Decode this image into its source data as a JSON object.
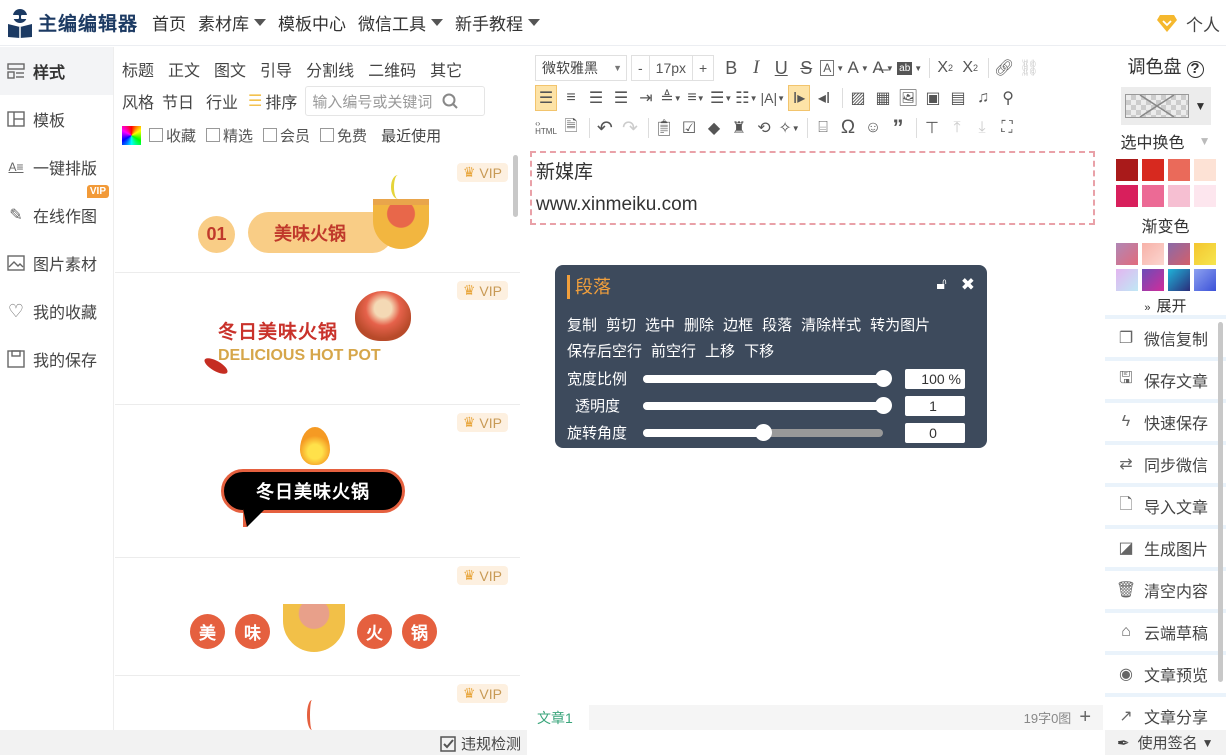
{
  "app": {
    "title": "主编编辑器"
  },
  "nav": [
    {
      "label": "首页",
      "dropdown": false
    },
    {
      "label": "素材库",
      "dropdown": true
    },
    {
      "label": "模板中心",
      "dropdown": false
    },
    {
      "label": "微信工具",
      "dropdown": true
    },
    {
      "label": "新手教程",
      "dropdown": true
    }
  ],
  "user": {
    "label": "个人",
    "icon": "diamond-icon"
  },
  "sidebar": {
    "items": [
      {
        "label": "样式",
        "icon": "style-icon",
        "active": true
      },
      {
        "label": "模板",
        "icon": "template-icon"
      },
      {
        "label": "一键排版",
        "icon": "auto-layout-icon"
      },
      {
        "label": "在线作图",
        "icon": "design-tools-icon",
        "badge": "VIP"
      },
      {
        "label": "图片素材",
        "icon": "image-icon"
      },
      {
        "label": "我的收藏",
        "icon": "heart-icon"
      },
      {
        "label": "我的保存",
        "icon": "save-icon"
      }
    ]
  },
  "library": {
    "categories_row1": [
      "标题",
      "正文",
      "图文",
      "引导",
      "分割线",
      "二维码",
      "其它"
    ],
    "categories_row2": [
      "风格",
      "节日",
      "行业"
    ],
    "sort_label": "排序",
    "search_placeholder": "输入编号或关键词",
    "filters": [
      "收藏",
      "精选",
      "会员",
      "免费"
    ],
    "recent_label": "最近使用",
    "cards": [
      {
        "badge": "VIP",
        "number": "01",
        "title": "美味火锅"
      },
      {
        "badge": "VIP",
        "title": "冬日美味火锅",
        "subtitle": "DELICIOUS HOT POT"
      },
      {
        "badge": "VIP",
        "title": "冬日美味火锅"
      },
      {
        "badge": "VIP",
        "chars": [
          "美",
          "味",
          "火",
          "锅"
        ]
      },
      {
        "badge": "VIP"
      }
    ],
    "violation_check": "违规检测"
  },
  "editor": {
    "font_family": "微软雅黑",
    "font_size": "17px",
    "size_minus": "-",
    "size_plus": "+",
    "content": [
      "新媒库",
      "www.xinmeiku.com"
    ],
    "tab": "文章1",
    "count": "19字0图",
    "add_tab": "+"
  },
  "popup": {
    "title": "段落",
    "actions": [
      "复制",
      "剪切",
      "选中",
      "删除",
      "边框",
      "段落",
      "清除样式",
      "转为图片",
      "保存",
      "后空行",
      "前空行",
      "上移",
      "下移"
    ],
    "sliders": [
      {
        "label": "宽度比例",
        "value": "100 %",
        "fraction": 1.0
      },
      {
        "label": "透明度",
        "value": "1",
        "fraction": 1.0
      },
      {
        "label": "旋转角度",
        "value": "0",
        "fraction": 0.5
      }
    ]
  },
  "palette": {
    "title": "调色盘",
    "swap_label": "选中换色",
    "solid_colors": [
      "#a91a1a",
      "#d7291f",
      "#ea6a5a",
      "#fde2d5",
      "#d81f5c",
      "#ec6a95",
      "#f6bfd2",
      "#fde6ee"
    ],
    "gradient_title": "渐变色",
    "gradients": [
      [
        "#b087b5",
        "#e26b7c"
      ],
      [
        "#f7b1a8",
        "#fbd6d0"
      ],
      [
        "#8a6aa8",
        "#d45f6a"
      ],
      [
        "#f4c52f",
        "#f6e64e"
      ],
      [
        "#e3b5f0",
        "#bfe8f5"
      ],
      [
        "#6b4db8",
        "#d12c9a"
      ],
      [
        "#1fb3d9",
        "#2b2c7a"
      ],
      [
        "#8da1f0",
        "#3c52d8"
      ]
    ],
    "expand_label": "展开"
  },
  "actions": [
    {
      "label": "微信复制",
      "icon": "copy-icon"
    },
    {
      "label": "保存文章",
      "icon": "save-icon"
    },
    {
      "label": "快速保存",
      "icon": "lightning-icon"
    },
    {
      "label": "同步微信",
      "icon": "sync-icon"
    },
    {
      "label": "导入文章",
      "icon": "import-icon"
    },
    {
      "label": "生成图片",
      "icon": "image-gen-icon"
    },
    {
      "label": "清空内容",
      "icon": "trash-icon"
    },
    {
      "label": "云端草稿",
      "icon": "cloud-draft-icon"
    },
    {
      "label": "文章预览",
      "icon": "eye-icon"
    },
    {
      "label": "文章分享",
      "icon": "share-icon"
    }
  ],
  "signature": {
    "label": "使用签名"
  }
}
